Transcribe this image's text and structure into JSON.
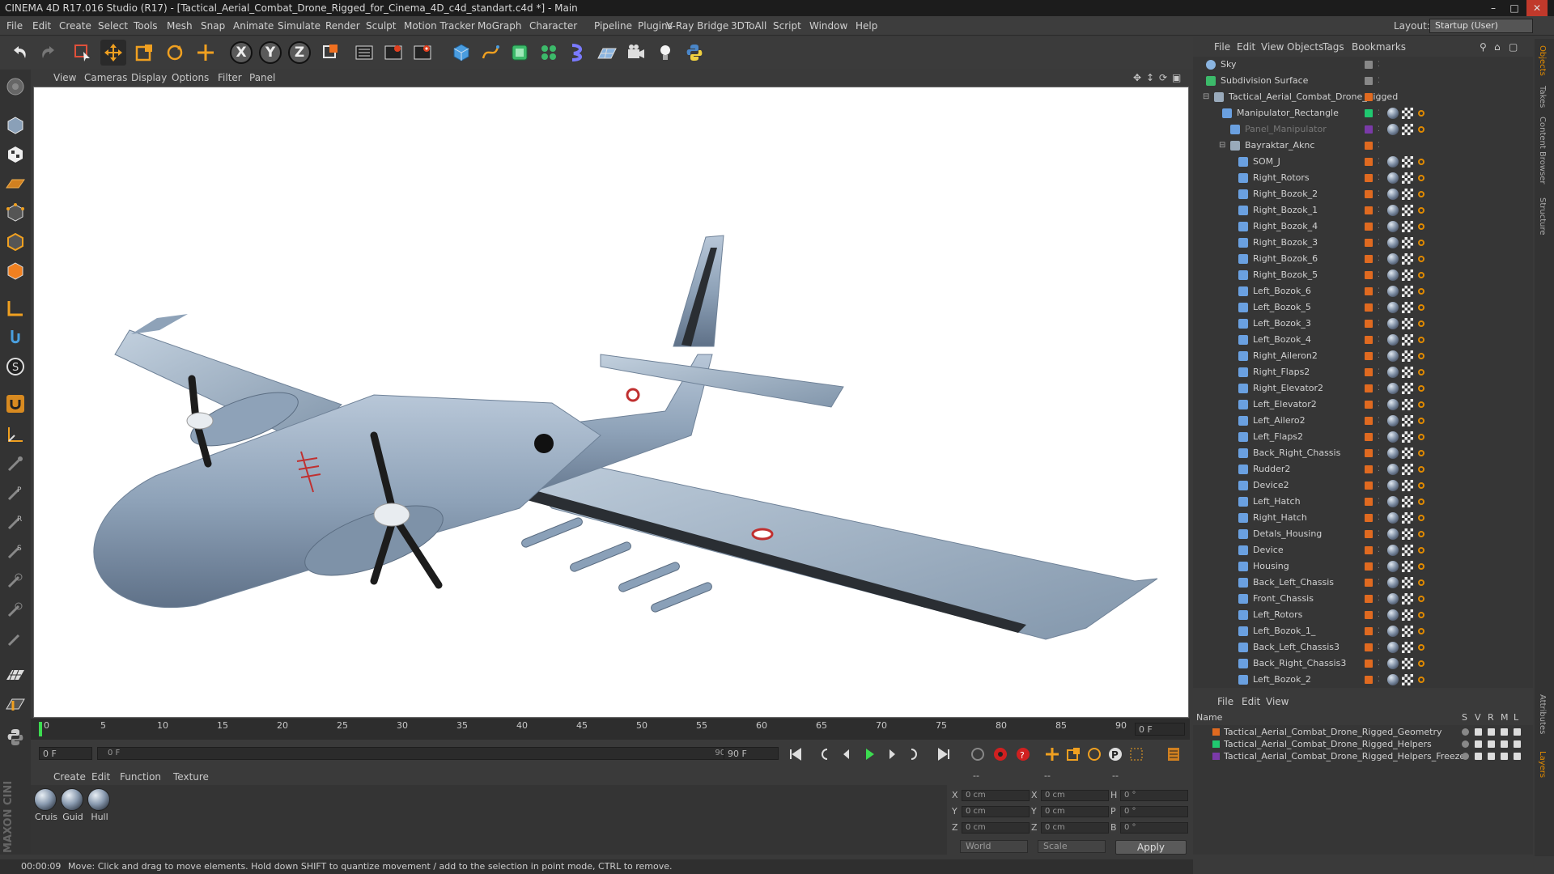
{
  "window": {
    "title": "CINEMA 4D R17.016 Studio (R17) - [Tactical_Aerial_Combat_Drone_Rigged_for_Cinema_4D_c4d_standart.c4d *] - Main"
  },
  "menubar": {
    "items": [
      "File",
      "Edit",
      "Create",
      "Select",
      "Tools",
      "Mesh",
      "Snap",
      "Animate",
      "Simulate",
      "Render",
      "Sculpt",
      "Motion Tracker",
      "MoGraph",
      "Character",
      "Pipeline",
      "Plugins",
      "V-Ray Bridge",
      "3DToAll",
      "Script",
      "Window",
      "Help"
    ],
    "layout_label": "Layout:",
    "layout_value": "Startup (User)"
  },
  "toolbar": {
    "axis_x": "X",
    "axis_y": "Y",
    "axis_z": "Z"
  },
  "viewport": {
    "menu": [
      "View",
      "Cameras",
      "Display",
      "Options",
      "Filter",
      "Panel"
    ]
  },
  "timeline": {
    "ticks": [
      "0",
      "5",
      "10",
      "15",
      "20",
      "25",
      "30",
      "35",
      "40",
      "45",
      "50",
      "55",
      "60",
      "65",
      "70",
      "75",
      "80",
      "85",
      "90"
    ],
    "end_field": "0 F",
    "current_frame": "0 F",
    "range_start": "0 F",
    "range_end": "90 F",
    "max_frame": "90 F"
  },
  "materials": {
    "menu": [
      "Create",
      "Edit",
      "Function",
      "Texture"
    ],
    "items": [
      "Cruis",
      "Guid",
      "Hull"
    ]
  },
  "coordinates": {
    "header_a": "--",
    "header_b": "--",
    "header_c": "--",
    "rows": [
      {
        "a": "X",
        "av": "0 cm",
        "b": "X",
        "bv": "0 cm",
        "c": "H",
        "cv": "0 °"
      },
      {
        "a": "Y",
        "av": "0 cm",
        "b": "Y",
        "bv": "0 cm",
        "c": "P",
        "cv": "0 °"
      },
      {
        "a": "Z",
        "av": "0 cm",
        "b": "Z",
        "bv": "0 cm",
        "c": "B",
        "cv": "0 °"
      }
    ],
    "mode_world": "World",
    "mode_scale": "Scale",
    "apply": "Apply"
  },
  "status": {
    "time": "00:00:09",
    "message": "Move: Click and drag to move elements. Hold down SHIFT to quantize movement / add to the selection in point mode, CTRL to remove."
  },
  "object_manager": {
    "menu": [
      "File",
      "Edit",
      "View",
      "Objects",
      "Tags",
      "Bookmarks"
    ],
    "rows": [
      {
        "name": "Sky",
        "indent": 0,
        "kind": "sky"
      },
      {
        "name": "Subdivision Surface",
        "indent": 0,
        "kind": "subdiv"
      },
      {
        "name": "Tactical_Aerial_Combat_Drone_Rigged",
        "indent": 1,
        "kind": "null"
      },
      {
        "name": "Manipulator_Rectangle",
        "indent": 2,
        "kind": "joint"
      },
      {
        "name": "Panel_Manipulator",
        "indent": 3,
        "kind": "joint",
        "dim": true
      },
      {
        "name": "Bayraktar_Aknc",
        "indent": 3,
        "kind": "null"
      },
      {
        "name": "SOM_J",
        "indent": 4,
        "kind": "joint"
      },
      {
        "name": "Right_Rotors",
        "indent": 4,
        "kind": "joint"
      },
      {
        "name": "Right_Bozok_2",
        "indent": 4,
        "kind": "joint"
      },
      {
        "name": "Right_Bozok_1",
        "indent": 4,
        "kind": "joint"
      },
      {
        "name": "Right_Bozok_4",
        "indent": 4,
        "kind": "joint"
      },
      {
        "name": "Right_Bozok_3",
        "indent": 4,
        "kind": "joint"
      },
      {
        "name": "Right_Bozok_6",
        "indent": 4,
        "kind": "joint"
      },
      {
        "name": "Right_Bozok_5",
        "indent": 4,
        "kind": "joint"
      },
      {
        "name": "Left_Bozok_6",
        "indent": 4,
        "kind": "joint"
      },
      {
        "name": "Left_Bozok_5",
        "indent": 4,
        "kind": "joint"
      },
      {
        "name": "Left_Bozok_3",
        "indent": 4,
        "kind": "joint"
      },
      {
        "name": "Left_Bozok_4",
        "indent": 4,
        "kind": "joint"
      },
      {
        "name": "Right_Aileron2",
        "indent": 4,
        "kind": "joint"
      },
      {
        "name": "Right_Flaps2",
        "indent": 4,
        "kind": "joint"
      },
      {
        "name": "Right_Elevator2",
        "indent": 4,
        "kind": "joint"
      },
      {
        "name": "Left_Elevator2",
        "indent": 4,
        "kind": "joint"
      },
      {
        "name": "Left_Ailero2",
        "indent": 4,
        "kind": "joint"
      },
      {
        "name": "Left_Flaps2",
        "indent": 4,
        "kind": "joint"
      },
      {
        "name": "Back_Right_Chassis",
        "indent": 4,
        "kind": "joint"
      },
      {
        "name": "Rudder2",
        "indent": 4,
        "kind": "joint"
      },
      {
        "name": "Device2",
        "indent": 4,
        "kind": "joint"
      },
      {
        "name": "Left_Hatch",
        "indent": 4,
        "kind": "joint"
      },
      {
        "name": "Right_Hatch",
        "indent": 4,
        "kind": "joint"
      },
      {
        "name": "Detals_Housing",
        "indent": 4,
        "kind": "joint"
      },
      {
        "name": "Device",
        "indent": 4,
        "kind": "joint"
      },
      {
        "name": "Housing",
        "indent": 4,
        "kind": "joint"
      },
      {
        "name": "Back_Left_Chassis",
        "indent": 4,
        "kind": "joint"
      },
      {
        "name": "Front_Chassis",
        "indent": 4,
        "kind": "joint"
      },
      {
        "name": "Left_Rotors",
        "indent": 4,
        "kind": "joint"
      },
      {
        "name": "Left_Bozok_1_",
        "indent": 4,
        "kind": "joint"
      },
      {
        "name": "Back_Left_Chassis3",
        "indent": 4,
        "kind": "joint"
      },
      {
        "name": "Back_Right_Chassis3",
        "indent": 4,
        "kind": "joint"
      },
      {
        "name": "Left_Bozok_2",
        "indent": 4,
        "kind": "joint"
      }
    ]
  },
  "layer_manager": {
    "menu": [
      "File",
      "Edit",
      "View"
    ],
    "header": {
      "name": "Name",
      "s": "S",
      "v": "V",
      "r": "R",
      "m": "M",
      "l": "L"
    },
    "layers": [
      {
        "name": "Tactical_Aerial_Combat_Drone_Rigged_Geometry",
        "color": "#e06a20"
      },
      {
        "name": "Tactical_Aerial_Combat_Drone_Rigged_Helpers",
        "color": "#20c870"
      },
      {
        "name": "Tactical_Aerial_Combat_Drone_Rigged_Helpers_Freeze",
        "color": "#7a3aa8"
      }
    ]
  },
  "side_tabs": [
    "Objects",
    "Takes",
    "Content Browser",
    "Structure",
    "Attributes",
    "Layers"
  ],
  "brand": "MAXON CINEMA 4D",
  "colors": {
    "accent": "#e08a00",
    "layer_orange": "#e06a20"
  }
}
